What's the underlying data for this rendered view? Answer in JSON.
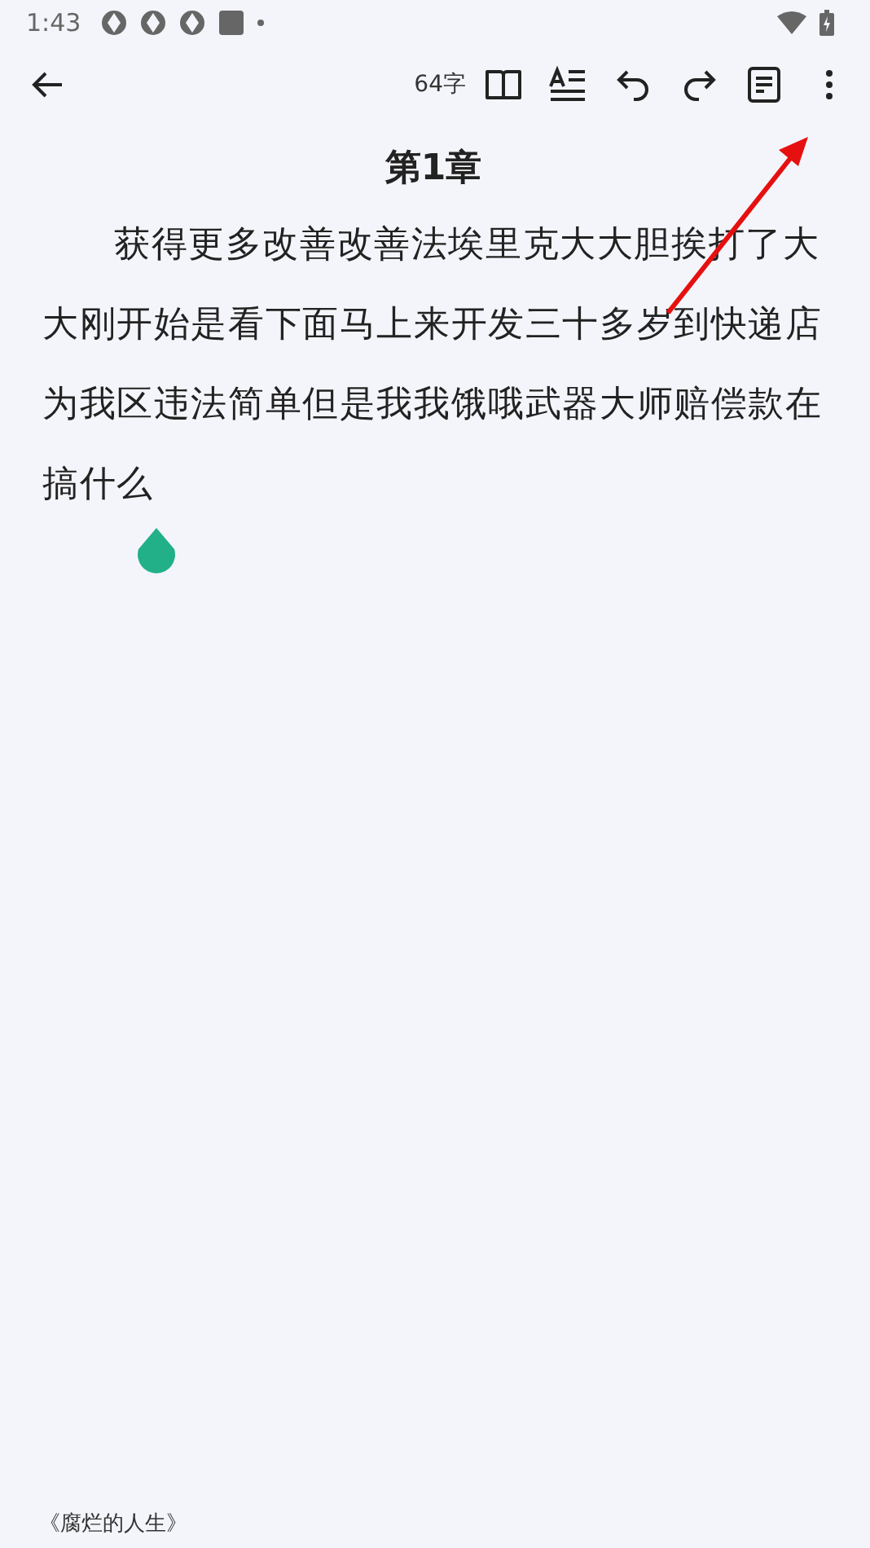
{
  "status_bar": {
    "time": "1:43"
  },
  "toolbar": {
    "word_count": "64字"
  },
  "chapter": {
    "title": "第1章",
    "body": "获得更多改善改善法埃里克大大胆挨打了大大刚开始是看下面马上来开发三十多岁到快递店为我区违法简单但是我我饿哦武器大师赔偿款在搞什么"
  },
  "footer": {
    "book_title": "《腐烂的人生》"
  }
}
